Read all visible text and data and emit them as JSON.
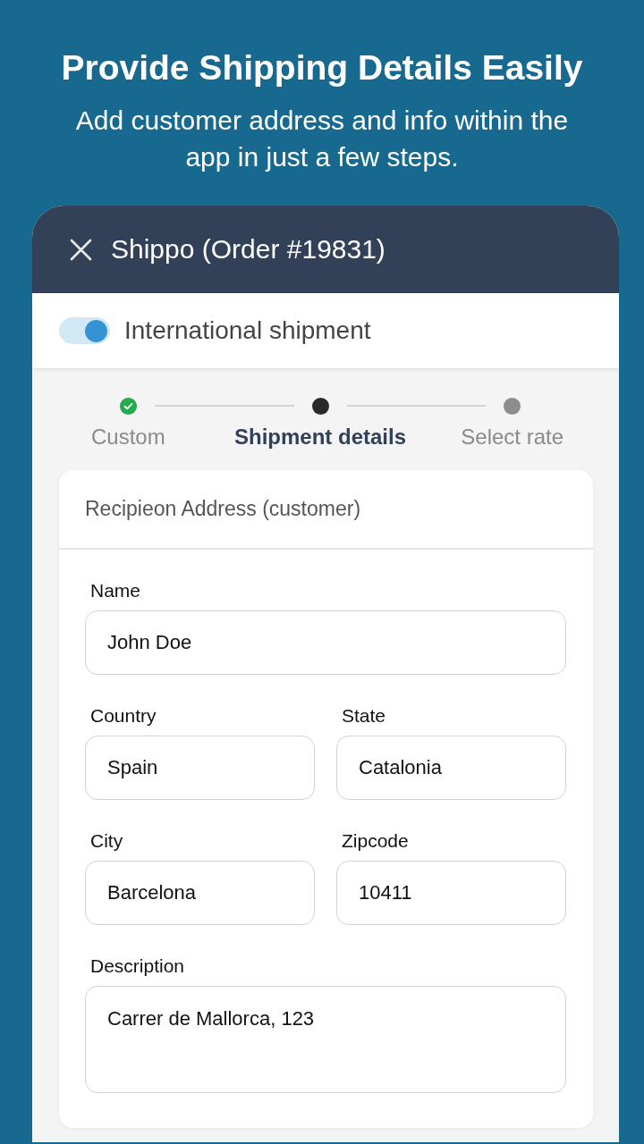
{
  "header": {
    "title": "Provide Shipping Details Easily",
    "subtitle": "Add customer address and info within the app in just a few steps."
  },
  "dialog": {
    "title": "Shippo (Order #19831)"
  },
  "toggle": {
    "label": "International shipment",
    "on": true
  },
  "steps": [
    {
      "label": "Custom",
      "completed": true,
      "selected": false
    },
    {
      "label": "Shipment details",
      "completed": false,
      "selected": true
    },
    {
      "label": "Select rate",
      "completed": false,
      "selected": false
    }
  ],
  "form": {
    "heading": "Recipieon Address (customer)",
    "rows": [
      {
        "fields": [
          {
            "label": "Name",
            "value": "John Doe",
            "kind": "text"
          }
        ]
      },
      {
        "fields": [
          {
            "label": "Country",
            "value": "Spain",
            "kind": "text"
          },
          {
            "label": "State",
            "value": "Catalonia",
            "kind": "text"
          }
        ]
      },
      {
        "fields": [
          {
            "label": "City",
            "value": "Barcelona",
            "kind": "text"
          },
          {
            "label": "Zipcode",
            "value": "10411",
            "kind": "text"
          }
        ]
      },
      {
        "fields": [
          {
            "label": "Description",
            "value": "Carrer de Mallorca, 123",
            "kind": "textarea"
          }
        ]
      }
    ]
  }
}
